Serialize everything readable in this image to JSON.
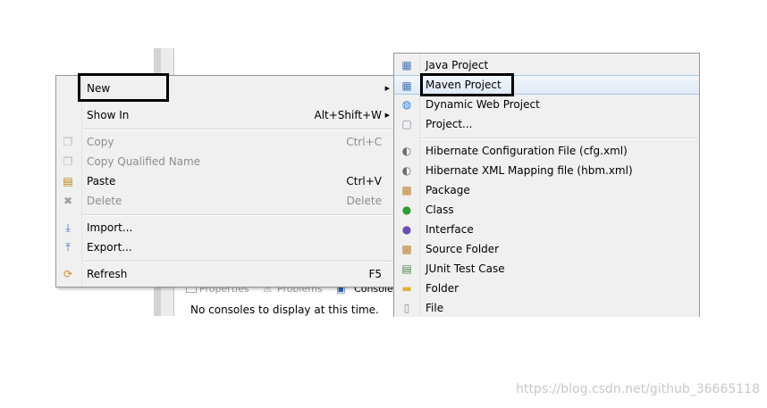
{
  "context_menu": {
    "items": [
      {
        "label": "New",
        "shortcut": "",
        "icon": "",
        "disabled": false,
        "submenu": true
      },
      {
        "label": "Show In",
        "shortcut": "Alt+Shift+W",
        "icon": "",
        "disabled": false,
        "submenu": true
      },
      {
        "label": "Copy",
        "shortcut": "Ctrl+C",
        "icon": "copy-icon",
        "disabled": true
      },
      {
        "label": "Copy Qualified Name",
        "shortcut": "",
        "icon": "copy-qualified-icon",
        "disabled": true
      },
      {
        "label": "Paste",
        "shortcut": "Ctrl+V",
        "icon": "paste-icon",
        "disabled": false
      },
      {
        "label": "Delete",
        "shortcut": "Delete",
        "icon": "delete-icon",
        "disabled": true
      },
      {
        "label": "Import...",
        "shortcut": "",
        "icon": "import-icon",
        "disabled": false
      },
      {
        "label": "Export...",
        "shortcut": "",
        "icon": "export-icon",
        "disabled": false
      },
      {
        "label": "Refresh",
        "shortcut": "F5",
        "icon": "refresh-icon",
        "disabled": false
      }
    ]
  },
  "new_submenu": {
    "items": [
      {
        "label": "Java Project",
        "icon": "java-project-icon"
      },
      {
        "label": "Maven Project",
        "icon": "maven-project-icon"
      },
      {
        "label": "Dynamic Web Project",
        "icon": "web-project-icon"
      },
      {
        "label": "Project...",
        "icon": "project-icon"
      },
      {
        "label": "Hibernate Configuration File (cfg.xml)",
        "icon": "hibernate-icon"
      },
      {
        "label": "Hibernate XML Mapping file (hbm.xml)",
        "icon": "hibernate-icon"
      },
      {
        "label": "Package",
        "icon": "package-icon"
      },
      {
        "label": "Class",
        "icon": "class-icon"
      },
      {
        "label": "Interface",
        "icon": "interface-icon"
      },
      {
        "label": "Source Folder",
        "icon": "source-folder-icon"
      },
      {
        "label": "JUnit Test Case",
        "icon": "junit-icon"
      },
      {
        "label": "Folder",
        "icon": "folder-icon"
      },
      {
        "label": "File",
        "icon": "file-icon"
      }
    ]
  },
  "console": {
    "tabs": [
      "Properties",
      "Problems",
      "Console"
    ],
    "message": "No consoles to display at this time."
  },
  "watermark": "https://blog.csdn.net/github_36665118",
  "colors": {
    "highlight": "#e4ecf7",
    "menu_bg": "#f0f0f0",
    "disabled_text": "#8d8d8d"
  }
}
